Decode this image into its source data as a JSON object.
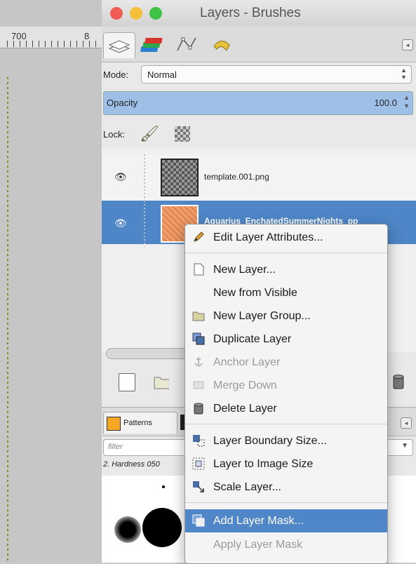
{
  "window": {
    "title": "Layers - Brushes"
  },
  "ruler": {
    "label_700": "700",
    "label_800": "8"
  },
  "layers_panel": {
    "mode_label": "Mode:",
    "mode_value": "Normal",
    "opacity_label": "Opacity",
    "opacity_value": "100.0",
    "lock_label": "Lock:",
    "layers": [
      {
        "name": "template.001.png",
        "visible": true,
        "selected": false
      },
      {
        "name": "Aquarius_EnchatedSummerNights_pp_",
        "visible": true,
        "selected": true
      }
    ]
  },
  "bottom_panel": {
    "patterns_tab_label": "Patterns",
    "filter_placeholder": "filter",
    "brush_name": "2. Hardness 050"
  },
  "context_menu": {
    "items": [
      {
        "label": "Edit Layer Attributes...",
        "icon": "pencil-icon",
        "enabled": true
      },
      {
        "label": "New Layer...",
        "icon": "new-page-icon",
        "enabled": true
      },
      {
        "label": "New from Visible",
        "icon": "",
        "enabled": true
      },
      {
        "label": "New Layer Group...",
        "icon": "folder-icon",
        "enabled": true
      },
      {
        "label": "Duplicate Layer",
        "icon": "duplicate-icon",
        "enabled": true
      },
      {
        "label": "Anchor Layer",
        "icon": "anchor-icon",
        "enabled": false
      },
      {
        "label": "Merge Down",
        "icon": "merge-icon",
        "enabled": false
      },
      {
        "label": "Delete Layer",
        "icon": "trash-icon",
        "enabled": true
      },
      {
        "label": "Layer Boundary Size...",
        "icon": "boundary-icon",
        "enabled": true
      },
      {
        "label": "Layer to Image Size",
        "icon": "layer-to-image-icon",
        "enabled": true
      },
      {
        "label": "Scale Layer...",
        "icon": "scale-icon",
        "enabled": true
      },
      {
        "label": "Add Layer Mask...",
        "icon": "mask-icon",
        "enabled": true,
        "highlighted": true
      },
      {
        "label": "Apply Layer Mask",
        "icon": "",
        "enabled": false
      }
    ]
  },
  "colors": {
    "selection": "#4f86c8",
    "opacity_bar": "#9ec0e6"
  }
}
